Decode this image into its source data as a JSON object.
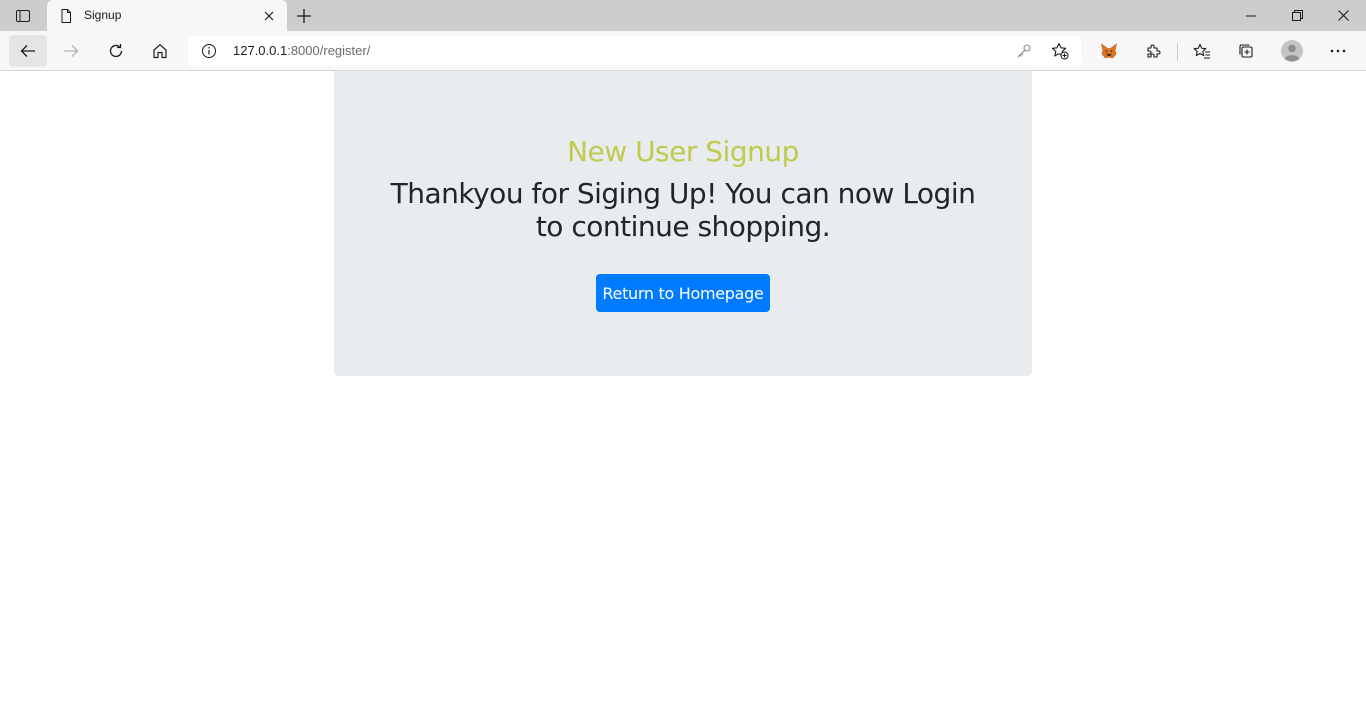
{
  "browser": {
    "tab": {
      "title": "Signup"
    },
    "address_bar": {
      "url_host": "127.0.0.1",
      "url_path": ":8000/register/"
    },
    "icons": {
      "tab_actions": "tab-actions-icon",
      "page": "page-icon",
      "close_tab": "close-icon",
      "new_tab": "plus-icon",
      "minimize": "minimize-icon",
      "restore": "restore-icon",
      "close_window": "close-icon",
      "back": "back-arrow-icon",
      "forward": "forward-arrow-icon",
      "refresh": "refresh-icon",
      "home": "home-icon",
      "site_info": "info-icon",
      "password_key": "key-icon",
      "add_favorite": "star-add-icon",
      "metamask_extension": "fox-icon",
      "extensions": "puzzle-icon",
      "favorites": "favorites-icon",
      "collections": "collections-icon",
      "profile": "avatar-icon",
      "more": "more-icon"
    }
  },
  "page": {
    "heading": "New User Signup",
    "message": "Thankyou for Siging Up! You can now Login to continue shopping.",
    "button_label": "Return to Homepage"
  },
  "colors": {
    "heading": "#c0ca4d",
    "button": "#007bff",
    "jumbotron_bg": "#e9ecef"
  }
}
